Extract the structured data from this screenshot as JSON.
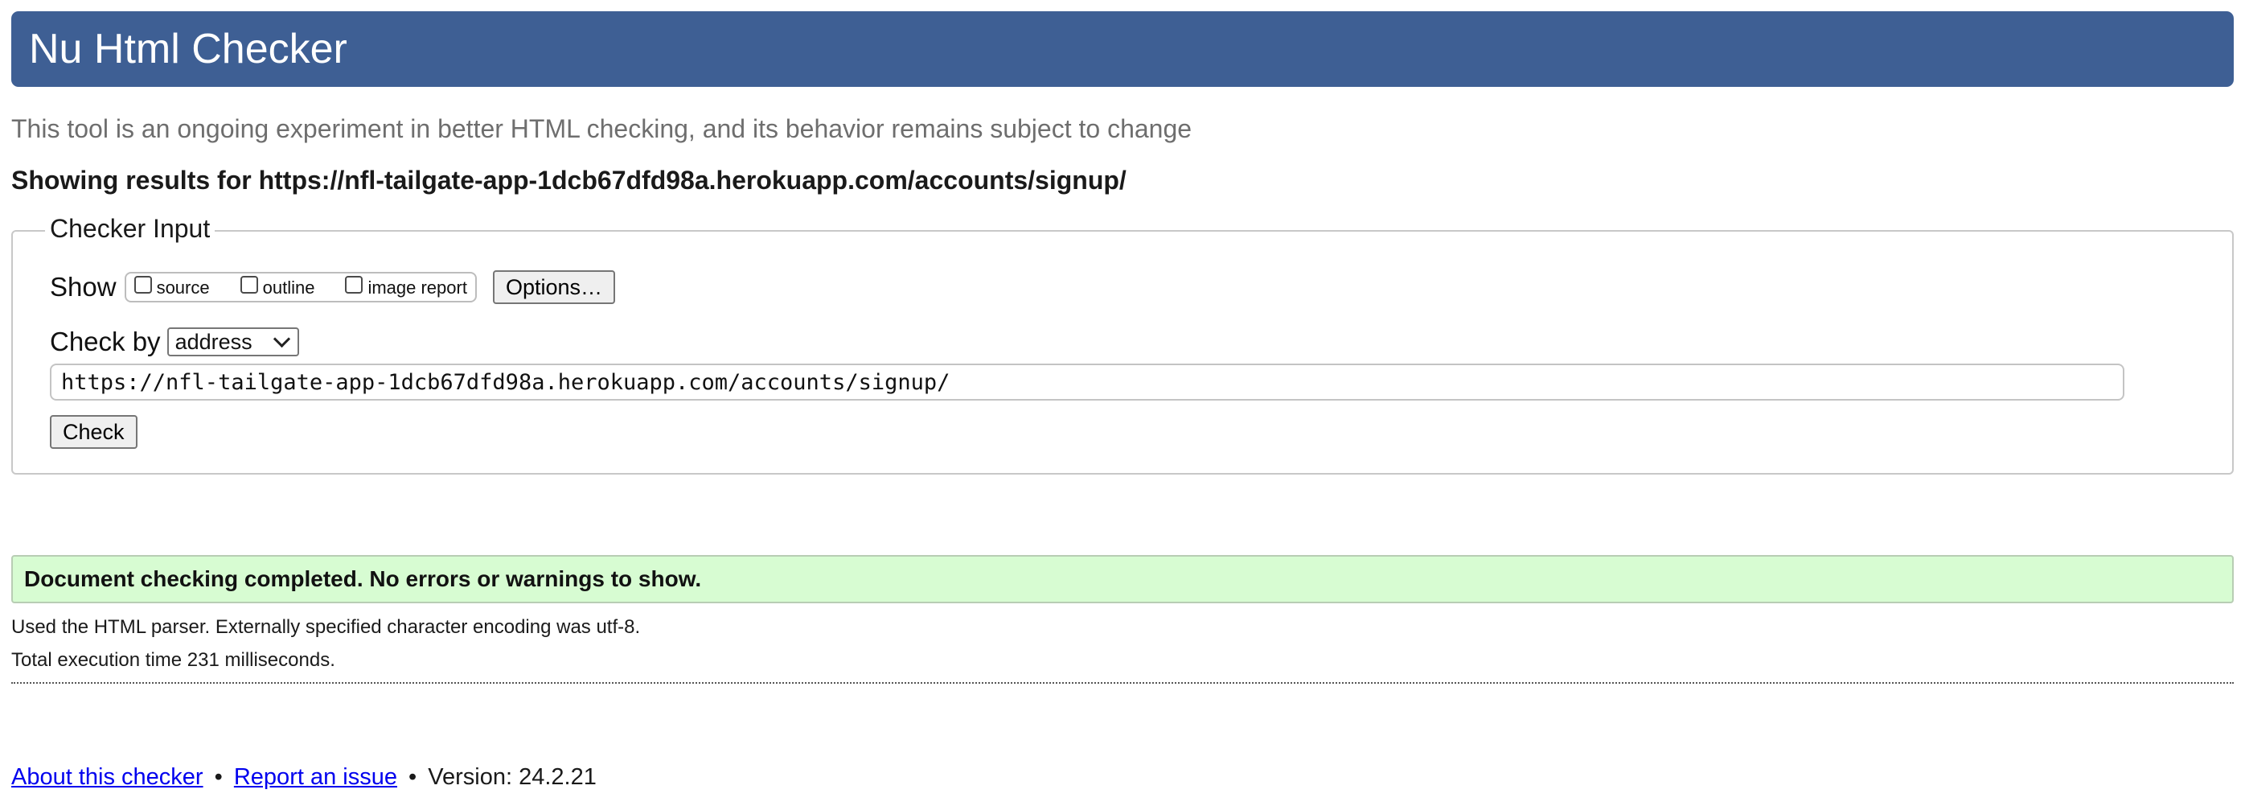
{
  "header": {
    "title": "Nu Html Checker"
  },
  "tagline": "This tool is an ongoing experiment in better HTML checking, and its behavior remains subject to change",
  "results_heading": "Showing results for https://nfl-tailgate-app-1dcb67dfd98a.herokuapp.com/accounts/signup/",
  "checker_input": {
    "legend": "Checker Input",
    "show_label": "Show",
    "show_options": [
      {
        "label": "source",
        "checked": false
      },
      {
        "label": "outline",
        "checked": false
      },
      {
        "label": "image report",
        "checked": false
      }
    ],
    "options_button": "Options…",
    "check_by_label": "Check by",
    "check_by_selected": "address",
    "url_value": "https://nfl-tailgate-app-1dcb67dfd98a.herokuapp.com/accounts/signup/",
    "check_button": "Check"
  },
  "result": {
    "message": "Document checking completed. No errors or warnings to show.",
    "parser_note": "Used the HTML parser. Externally specified character encoding was utf-8.",
    "timing_note": "Total execution time 231 milliseconds.",
    "status_color": "#d7fcd2"
  },
  "footer": {
    "about_link": "About this checker",
    "separator": "•",
    "report_link": "Report an issue",
    "version": "Version: 24.2.21"
  },
  "colors": {
    "header_bg": "#3e5f94",
    "link": "#0000ee"
  }
}
